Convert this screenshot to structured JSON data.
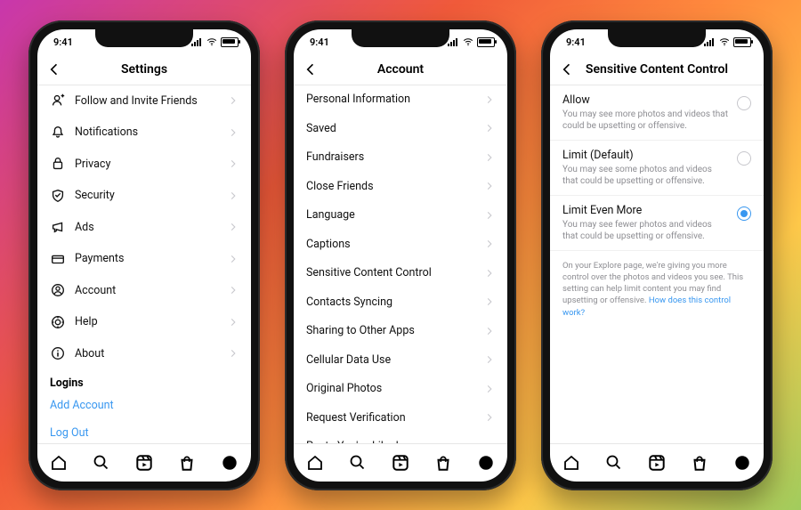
{
  "status": {
    "time": "9:41"
  },
  "phones": {
    "settings": {
      "title": "Settings",
      "items": [
        {
          "icon": "add-friends-icon",
          "label": "Follow and Invite Friends"
        },
        {
          "icon": "bell-icon",
          "label": "Notifications"
        },
        {
          "icon": "lock-icon",
          "label": "Privacy"
        },
        {
          "icon": "shield-icon",
          "label": "Security"
        },
        {
          "icon": "megaphone-icon",
          "label": "Ads"
        },
        {
          "icon": "card-icon",
          "label": "Payments"
        },
        {
          "icon": "account-icon",
          "label": "Account"
        },
        {
          "icon": "help-icon",
          "label": "Help"
        },
        {
          "icon": "info-icon",
          "label": "About"
        }
      ],
      "logins_header": "Logins",
      "links": [
        {
          "label": "Add Account"
        },
        {
          "label": "Log Out"
        }
      ]
    },
    "account": {
      "title": "Account",
      "items": [
        {
          "label": "Personal Information"
        },
        {
          "label": "Saved"
        },
        {
          "label": "Fundraisers"
        },
        {
          "label": "Close Friends"
        },
        {
          "label": "Language"
        },
        {
          "label": "Captions"
        },
        {
          "label": "Sensitive Content Control"
        },
        {
          "label": "Contacts Syncing"
        },
        {
          "label": "Sharing to Other Apps"
        },
        {
          "label": "Cellular Data Use"
        },
        {
          "label": "Original Photos"
        },
        {
          "label": "Request Verification"
        },
        {
          "label": "Posts You've Liked"
        }
      ]
    },
    "scc": {
      "title": "Sensitive Content Control",
      "options": [
        {
          "title": "Allow",
          "desc": "You may see more photos and videos that could be upsetting or offensive.",
          "selected": false
        },
        {
          "title": "Limit (Default)",
          "desc": "You may see some photos and videos that could be upsetting or offensive.",
          "selected": false
        },
        {
          "title": "Limit Even More",
          "desc": "You may see fewer photos and videos that could be upsetting or offensive.",
          "selected": true
        }
      ],
      "footer_text": "On your Explore page, we're giving you more control over the photos and videos you see. This setting can help limit content you may find upsetting or offensive. ",
      "footer_link": "How does this control work?"
    }
  }
}
